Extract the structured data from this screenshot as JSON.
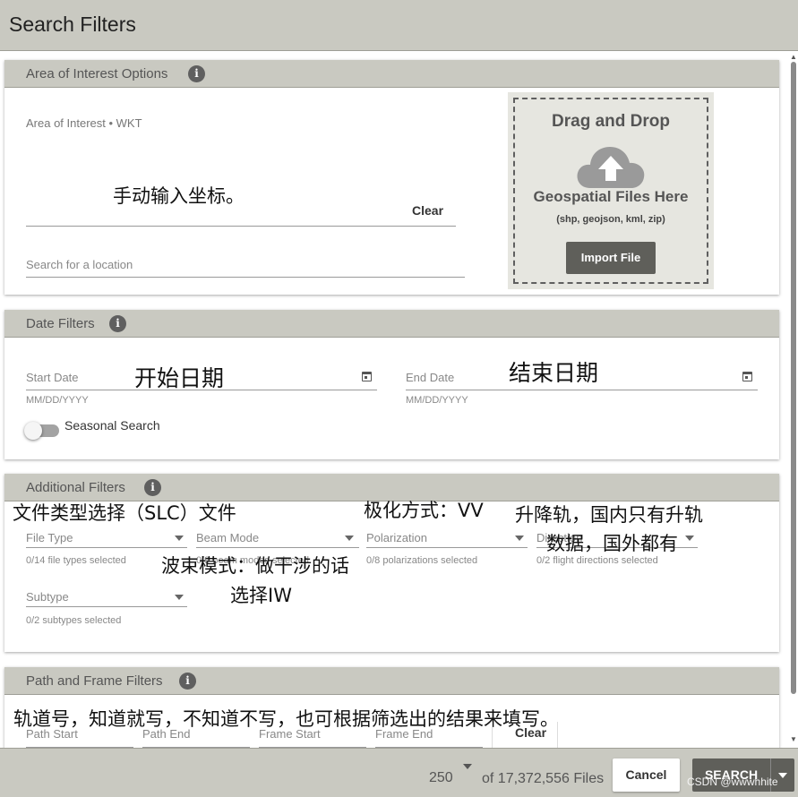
{
  "window": {
    "title": "Search Filters"
  },
  "aoi": {
    "header": "Area of Interest Options",
    "wkt_label": "Area of Interest • WKT",
    "clear_label": "Clear",
    "location_placeholder": "Search for a location",
    "dropzone": {
      "title": "Drag and Drop",
      "subtitle": "Geospatial Files Here",
      "formats": "(shp, geojson, kml, zip)",
      "import_label": "Import File"
    }
  },
  "date": {
    "header": "Date Filters",
    "start_label": "Start Date",
    "start_hint": "MM/DD/YYYY",
    "end_label": "End Date",
    "end_hint": "MM/DD/YYYY",
    "seasonal_label": "Seasonal Search"
  },
  "additional": {
    "header": "Additional Filters",
    "file_type": {
      "label": "File Type",
      "hint": "0/14 file types selected"
    },
    "beam_mode": {
      "label": "Beam Mode",
      "hint": "0/9 beam modes selected"
    },
    "polarization": {
      "label": "Polarization",
      "hint": "0/8 polarizations selected"
    },
    "direction": {
      "label": "Direction",
      "hint": "0/2 flight directions selected"
    },
    "subtype": {
      "label": "Subtype",
      "hint": "0/2 subtypes selected"
    }
  },
  "path_frame": {
    "header": "Path and Frame Filters",
    "path_start": "Path Start",
    "path_end": "Path End",
    "frame_start": "Frame Start",
    "frame_end": "Frame End",
    "clear_label": "Clear"
  },
  "annotations": {
    "aoi": "手动输入坐标。",
    "start_date": "开始日期",
    "end_date": "结束日期",
    "file_type": "文件类型选择（SLC）文件",
    "polarization": "极化方式：VV",
    "direction_line1": "升降轨，国内只有升轨",
    "direction_line2": "数据，国外都有",
    "beam_line1": "波束模式：做干涉的话",
    "beam_line2": "选择IW",
    "path_frame": "轨道号，知道就写，不知道不写，也可根据筛选出的结果来填写。"
  },
  "footer": {
    "max_results": "250",
    "results_text": "of 17,372,556 Files",
    "cancel_label": "Cancel",
    "search_label": "SEARCH",
    "watermark": "CSDN @wwwhhite"
  },
  "colors": {
    "chrome": "#c9c9c1",
    "button_dark": "#5f5f5a",
    "dropzone_bg": "#e6e6e0"
  }
}
